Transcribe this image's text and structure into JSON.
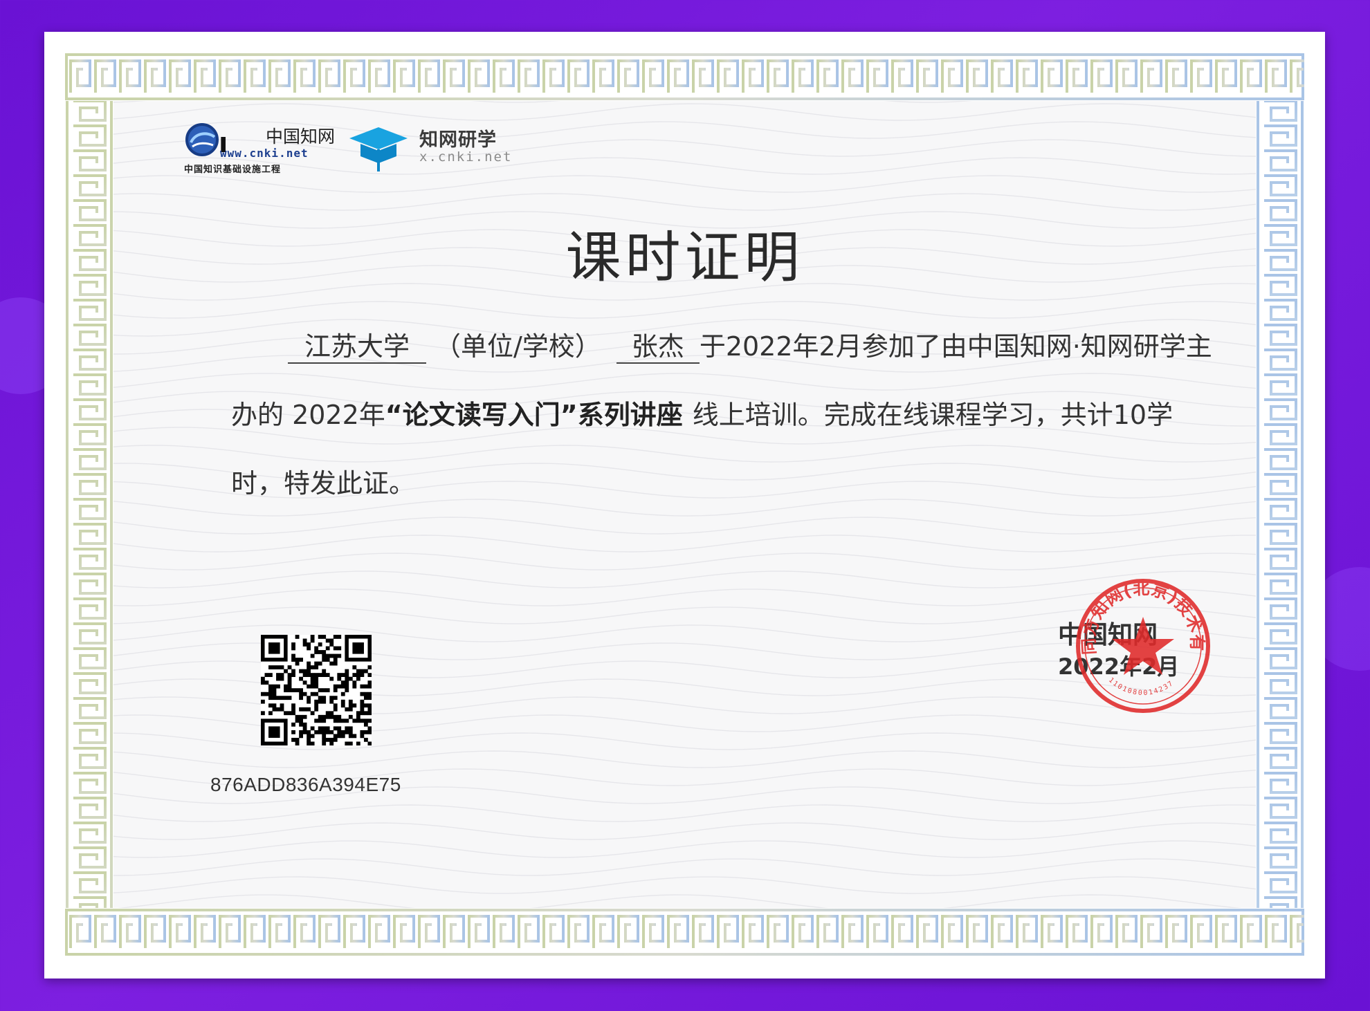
{
  "logos": {
    "cnki_chinese": "中国知网",
    "cnki_url": "www.cnki.net",
    "cnki_subtitle": "中国知识基础设施工程",
    "yanxue_name": "知网研学",
    "yanxue_url": "x.cnki.net"
  },
  "certificate": {
    "title": "课时证明",
    "school": "江苏大学",
    "school_suffix": "（单位/学校）",
    "name": "张杰",
    "line1_rest": "于2022年2月参加了由中国知网·知网研学主",
    "line2_prefix": "办的 2022年",
    "course_name": "“论文读写入门”系列讲座",
    "line2_rest": "线上培训。完成在线课程学习，共计10学",
    "line3": "时，特发此证。",
    "code": "876ADD836A394E75",
    "issuer": "中国知网",
    "date": "2022年2月"
  },
  "seal": {
    "text": "同方知网(北京)技术有限公司",
    "number": "1101080014237",
    "color": "#e02a2a"
  },
  "colors": {
    "background": "#6a12d4",
    "border_green": "#c9d3a8",
    "border_blue": "#a9c4e6"
  }
}
